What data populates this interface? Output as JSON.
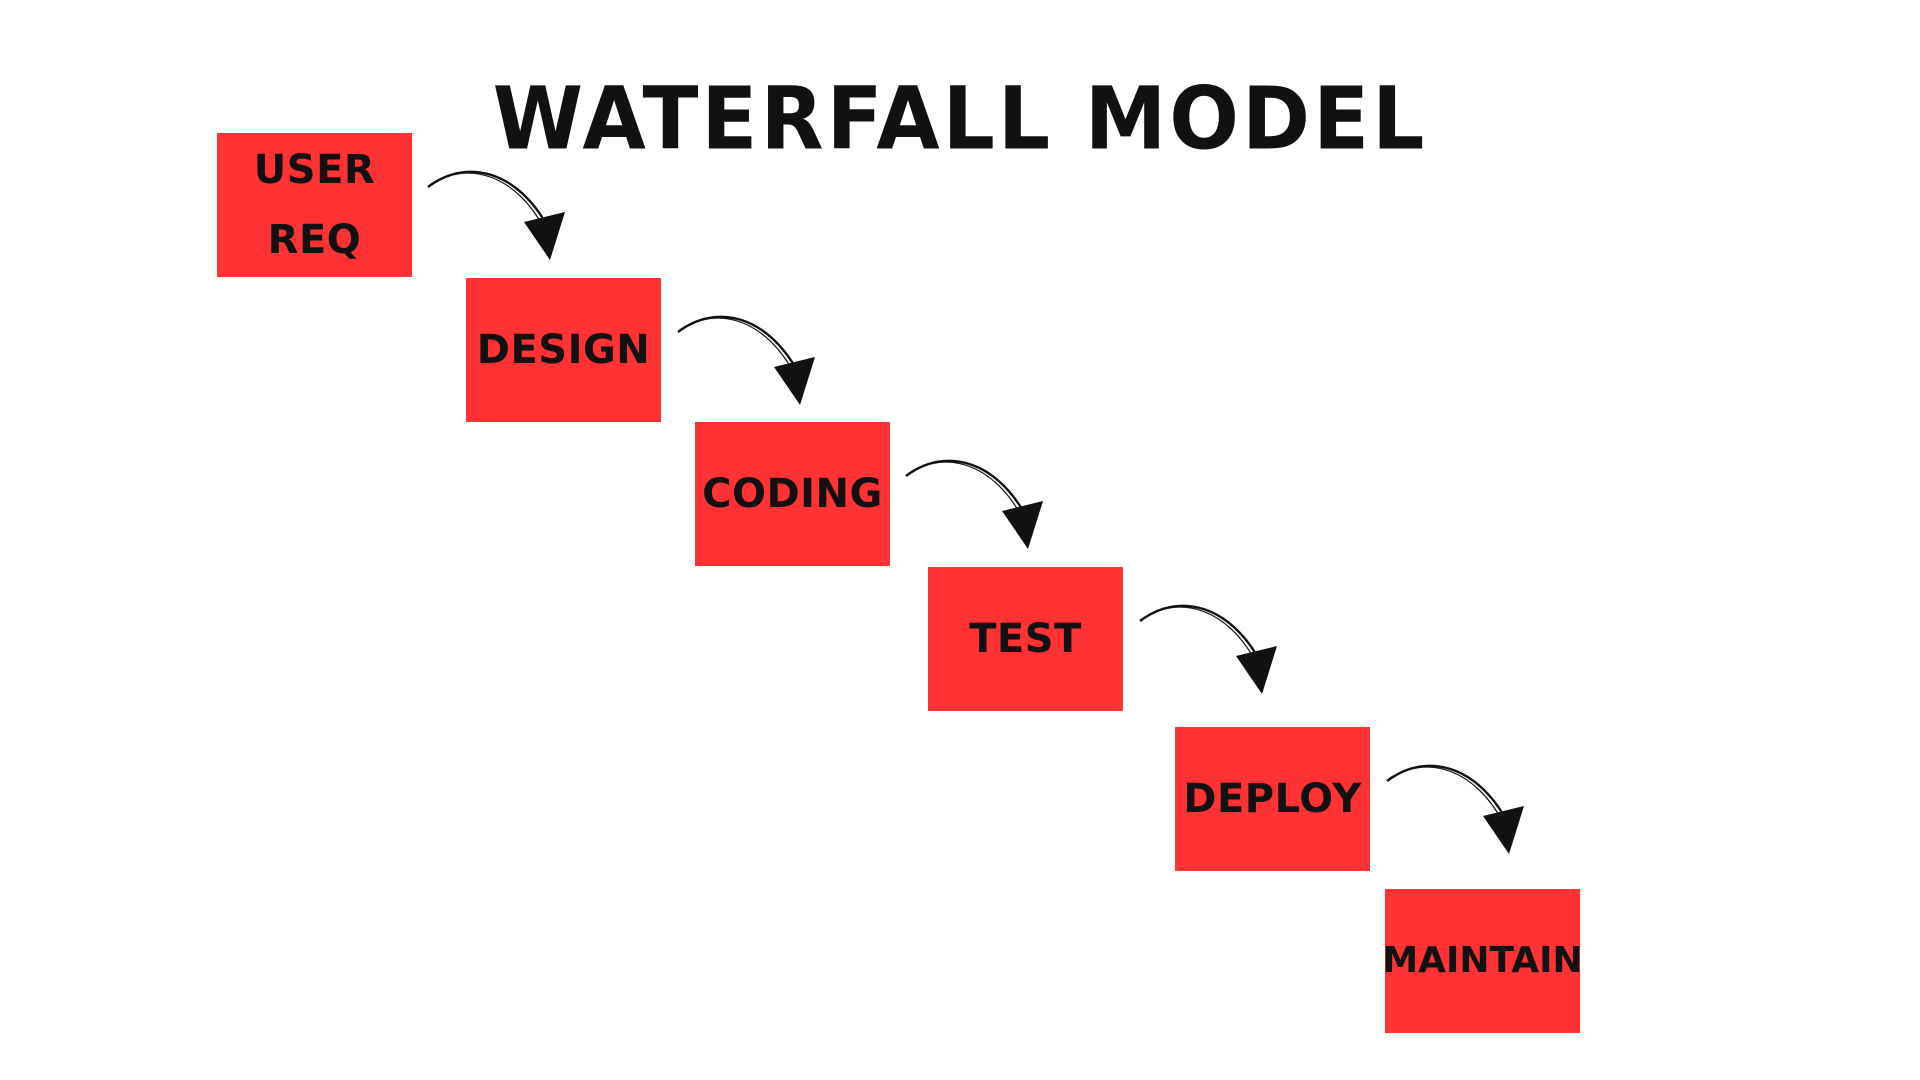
{
  "title": "WATERFALL MODEL",
  "steps": [
    {
      "label": "USER\nREQ"
    },
    {
      "label": "DESIGN"
    },
    {
      "label": "CODING"
    },
    {
      "label": "TEST"
    },
    {
      "label": "DEPLOY"
    },
    {
      "label": "MAINTAIN"
    }
  ],
  "colors": {
    "box": "#ff3333",
    "text": "#111111",
    "arrow": "#111111",
    "background": "#ffffff"
  },
  "icons": {
    "connector": "curved-arrow-icon"
  }
}
